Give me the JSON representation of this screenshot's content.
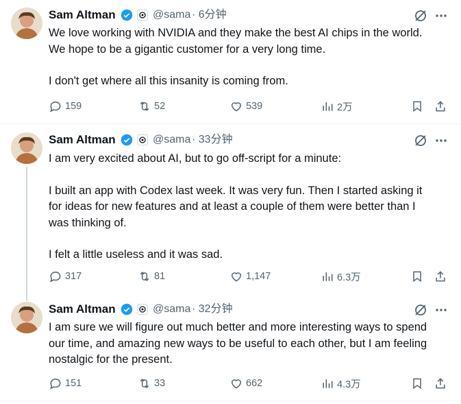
{
  "colors": {
    "text": "#0f1419",
    "muted": "#536471",
    "verified": "#1d9bf0",
    "border": "#eff3f4"
  },
  "tweets": [
    {
      "name": "Sam Altman",
      "handle": "@sama",
      "time": "· 6分钟",
      "paragraphs": [
        "We love working with NVIDIA and they make the best AI chips in the world.\nWe hope to be a gigantic customer for a very long time.",
        "I don't get where all this insanity is coming from."
      ],
      "replies": "159",
      "reposts": "52",
      "likes": "539",
      "views": "2万"
    },
    {
      "name": "Sam Altman",
      "handle": "@sama",
      "time": "· 33分钟",
      "paragraphs": [
        "I am very excited about AI, but to go off-script for a minute:",
        "I built an app with Codex last week. It was very fun. Then I started asking it\nfor ideas for new features and at least a couple of them were better than I\nwas thinking of.",
        "I felt a little useless and it was sad."
      ],
      "replies": "317",
      "reposts": "81",
      "likes": "1,147",
      "views": "6.3万"
    },
    {
      "name": "Sam Altman",
      "handle": "@sama",
      "time": "· 32分钟",
      "paragraphs": [
        "I am sure we will figure out much better and more interesting ways to spend\nour time, and amazing new ways to be useful to each other, but I am feeling\nnostalgic for the present."
      ],
      "replies": "151",
      "reposts": "33",
      "likes": "662",
      "views": "4.3万"
    }
  ]
}
